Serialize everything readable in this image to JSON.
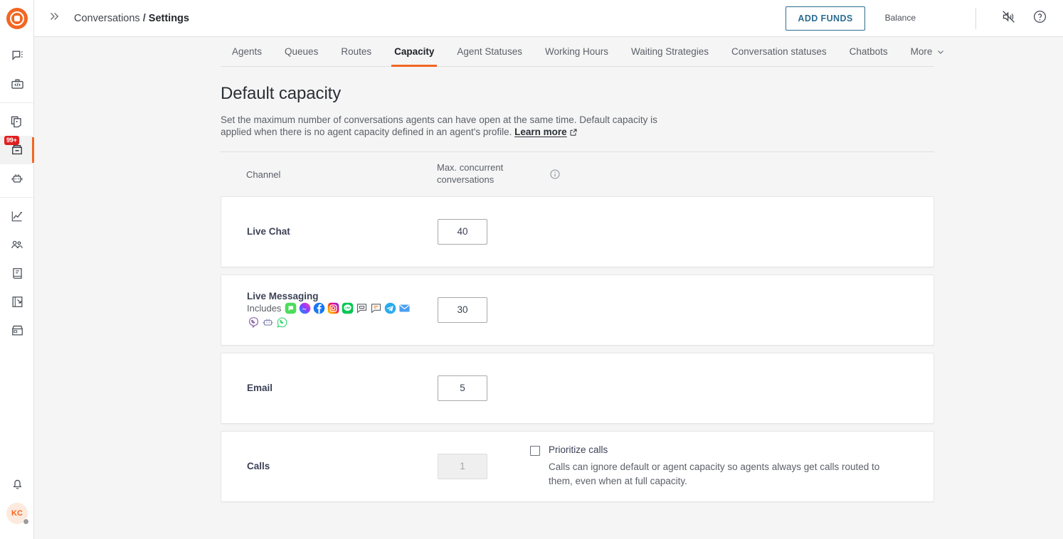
{
  "brand": {
    "accent": "#f26722",
    "link": "#2b6c8f",
    "badge_bg": "#e02020"
  },
  "sidebar": {
    "logo_name": "brand-logo",
    "groups": [
      {
        "items": [
          {
            "name": "conversations-icon",
            "badge": ""
          },
          {
            "name": "developer-tools-icon",
            "badge": ""
          }
        ]
      },
      {
        "items": [
          {
            "name": "copy-documents-icon",
            "badge": ""
          },
          {
            "name": "inbox-icon",
            "badge": "99+",
            "active": true
          },
          {
            "name": "bot-icon",
            "badge": ""
          }
        ]
      },
      {
        "items": [
          {
            "name": "analytics-icon",
            "badge": ""
          },
          {
            "name": "contacts-icon",
            "badge": ""
          },
          {
            "name": "knowledge-base-icon",
            "badge": ""
          },
          {
            "name": "campaigns-icon",
            "badge": ""
          },
          {
            "name": "marketplace-icon",
            "badge": ""
          }
        ]
      }
    ],
    "bottom": {
      "notifications_icon": "bell-icon",
      "avatar_initials": "KC",
      "status": "away"
    }
  },
  "topbar": {
    "expand_icon": "chevron-double-right-icon",
    "breadcrumb": {
      "parent": "Conversations",
      "separator": "/",
      "current": "Settings"
    },
    "add_funds_label": "ADD FUNDS",
    "balance_label": "Balance",
    "mute_icon": "speaker-muted-icon",
    "help_icon": "help-circle-icon"
  },
  "tabs": {
    "items": [
      {
        "label": "Agents",
        "active": false
      },
      {
        "label": "Queues",
        "active": false
      },
      {
        "label": "Routes",
        "active": false
      },
      {
        "label": "Capacity",
        "active": true
      },
      {
        "label": "Agent Statuses",
        "active": false
      },
      {
        "label": "Working Hours",
        "active": false
      },
      {
        "label": "Waiting Strategies",
        "active": false
      },
      {
        "label": "Conversation statuses",
        "active": false
      },
      {
        "label": "Chatbots",
        "active": false
      },
      {
        "label": "More",
        "active": false,
        "caret": true
      }
    ]
  },
  "page": {
    "title": "Default capacity",
    "description_part1": "Set the maximum number of conversations agents can have open at the same time. Default capacity is applied when there is no agent capacity defined in an agent's profile.",
    "learn_more_label": "Learn more",
    "external_link_icon": "external-link-icon"
  },
  "table": {
    "headers": {
      "channel": "Channel",
      "max_concurrent": "Max. concurrent conversations",
      "info_icon": "info-circle-icon"
    },
    "rows": [
      {
        "channel": "Live Chat",
        "includes_label": "",
        "icons": [],
        "value": "40",
        "disabled": false
      },
      {
        "channel": "Live Messaging",
        "includes_label": "Includes",
        "icons": [
          "whatsapp-business-icon",
          "messenger-icon",
          "facebook-icon",
          "instagram-icon",
          "line-icon",
          "chat-bubble-icon",
          "sms-bubble-icon",
          "telegram-icon",
          "email-icon",
          "viber-icon",
          "bot-icon",
          "whatsapp-icon"
        ],
        "value": "30",
        "disabled": false
      },
      {
        "channel": "Email",
        "includes_label": "",
        "icons": [],
        "value": "5",
        "disabled": false
      },
      {
        "channel": "Calls",
        "includes_label": "",
        "icons": [],
        "value": "1",
        "disabled": true,
        "extra": {
          "checkbox_label": "Prioritize calls",
          "checkbox_checked": false,
          "help_text": "Calls can ignore default or agent capacity so agents always get calls routed to them, even when at full capacity."
        }
      }
    ]
  }
}
